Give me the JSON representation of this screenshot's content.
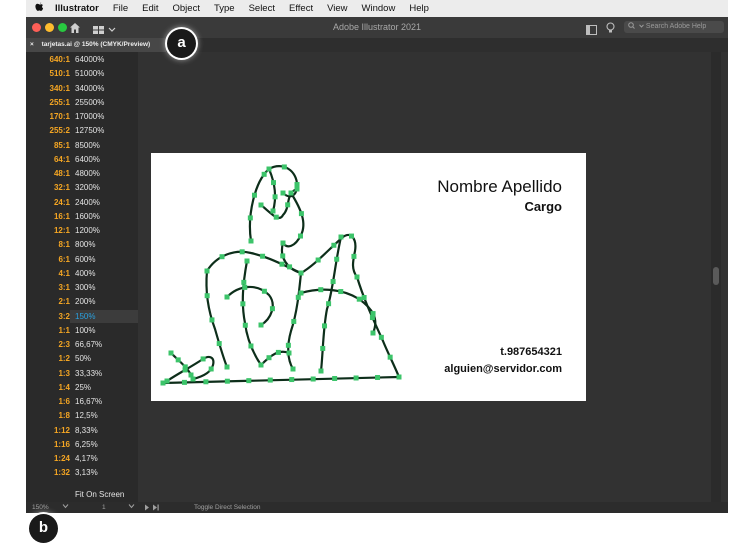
{
  "menubar": {
    "app": "Illustrator",
    "items": [
      "File",
      "Edit",
      "Object",
      "Type",
      "Select",
      "Effect",
      "View",
      "Window",
      "Help"
    ]
  },
  "window": {
    "title": "Adobe Illustrator 2021",
    "search_placeholder": "Search Adobe Help"
  },
  "tab": {
    "close": "×",
    "label": "tarjetas.ai @ 150% (CMYK/Preview)"
  },
  "zoom_menu": {
    "items": [
      {
        "ratio": "640:1",
        "pct": "64000%"
      },
      {
        "ratio": "510:1",
        "pct": "51000%"
      },
      {
        "ratio": "340:1",
        "pct": "34000%"
      },
      {
        "ratio": "255:1",
        "pct": "25500%"
      },
      {
        "ratio": "170:1",
        "pct": "17000%"
      },
      {
        "ratio": "255:2",
        "pct": "12750%"
      },
      {
        "ratio": "85:1",
        "pct": "8500%"
      },
      {
        "ratio": "64:1",
        "pct": "6400%"
      },
      {
        "ratio": "48:1",
        "pct": "4800%"
      },
      {
        "ratio": "32:1",
        "pct": "3200%"
      },
      {
        "ratio": "24:1",
        "pct": "2400%"
      },
      {
        "ratio": "16:1",
        "pct": "1600%"
      },
      {
        "ratio": "12:1",
        "pct": "1200%"
      },
      {
        "ratio": "8:1",
        "pct": "800%"
      },
      {
        "ratio": "6:1",
        "pct": "600%"
      },
      {
        "ratio": "4:1",
        "pct": "400%"
      },
      {
        "ratio": "3:1",
        "pct": "300%"
      },
      {
        "ratio": "2:1",
        "pct": "200%"
      },
      {
        "ratio": "3:2",
        "pct": "150%"
      },
      {
        "ratio": "1:1",
        "pct": "100%"
      },
      {
        "ratio": "2:3",
        "pct": "66,67%"
      },
      {
        "ratio": "1:2",
        "pct": "50%"
      },
      {
        "ratio": "1:3",
        "pct": "33,33%"
      },
      {
        "ratio": "1:4",
        "pct": "25%"
      },
      {
        "ratio": "1:6",
        "pct": "16,67%"
      },
      {
        "ratio": "1:8",
        "pct": "12,5%"
      },
      {
        "ratio": "1:12",
        "pct": "8,33%"
      },
      {
        "ratio": "1:16",
        "pct": "6,25%"
      },
      {
        "ratio": "1:24",
        "pct": "4,17%"
      },
      {
        "ratio": "1:32",
        "pct": "3,13%"
      }
    ],
    "selected": "150%",
    "fit_label": "Fit On Screen"
  },
  "card": {
    "name": "Nombre Apellido",
    "role": "Cargo",
    "phone": "t.987654321",
    "email": "alguien@servidor.com"
  },
  "statusbar": {
    "zoom": "150%",
    "artboard": "1",
    "tool": "Toggle Direct Selection"
  },
  "badges": {
    "a": "a",
    "b": "b"
  },
  "colors": {
    "ratio": "#f5a623",
    "selected": "#2aa1e0",
    "path_stroke": "#0d2e1a",
    "anchor": "#3cc46a",
    "close_dot": "#fe5f57",
    "min_dot": "#febc2e",
    "max_dot": "#28c840"
  },
  "icons": [
    "apple-icon",
    "home-icon",
    "workspace-switcher-icon",
    "panel-icon",
    "lightbulb-icon",
    "search-icon",
    "chevron-down-icon"
  ]
}
